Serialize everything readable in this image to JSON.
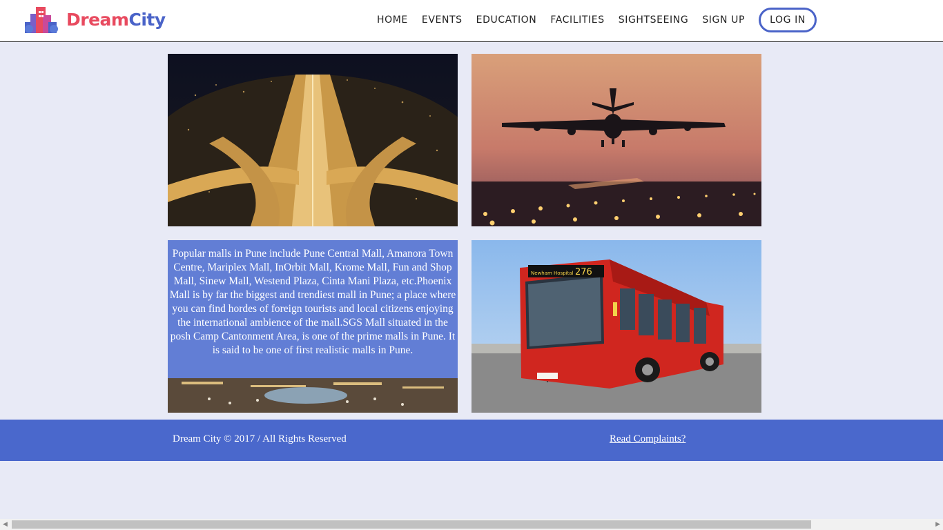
{
  "brand": {
    "part1": "Dream",
    "part2": "City",
    "logo_icon": "city-buildings-logo"
  },
  "nav": {
    "items": [
      "HOME",
      "EVENTS",
      "EDUCATION",
      "FACILITIES",
      "SIGHTSEEING",
      "SIGN UP"
    ],
    "login": "LOG IN"
  },
  "tiles": {
    "highway": {
      "icon": "highway-night-photo"
    },
    "airplane": {
      "icon": "airplane-landing-photo"
    },
    "mall": {
      "icon": "mall-plaza-photo",
      "caption": "Popular malls in Pune include Pune Central Mall, Amanora Town Centre, Mariplex Mall, InOrbit Mall, Krome Mall, Fun and Shop Mall, Sinew Mall, Westend Plaza, Cinta Mani Plaza, etc.Phoenix Mall is by far the biggest and trendiest mall in Pune; a place where you can find hordes of foreign tourists and local citizens enjoying the international ambience of the mall.SGS Mall situated in the posh Camp Cantonment Area, is one of the prime malls in Pune. It is said to be one of first realistic malls in Pune."
    },
    "bus": {
      "icon": "red-bus-photo",
      "route": "276",
      "destination": "Newham Hospital"
    }
  },
  "footer": {
    "copyright": "Dream City © 2017 / All Rights Reserved",
    "complaints": "Read Complaints?"
  },
  "colors": {
    "accent": "#4a63c8",
    "brand_red": "#e84a5f",
    "footer_bg": "#4a68cc",
    "page_bg": "#e8eaf6"
  }
}
